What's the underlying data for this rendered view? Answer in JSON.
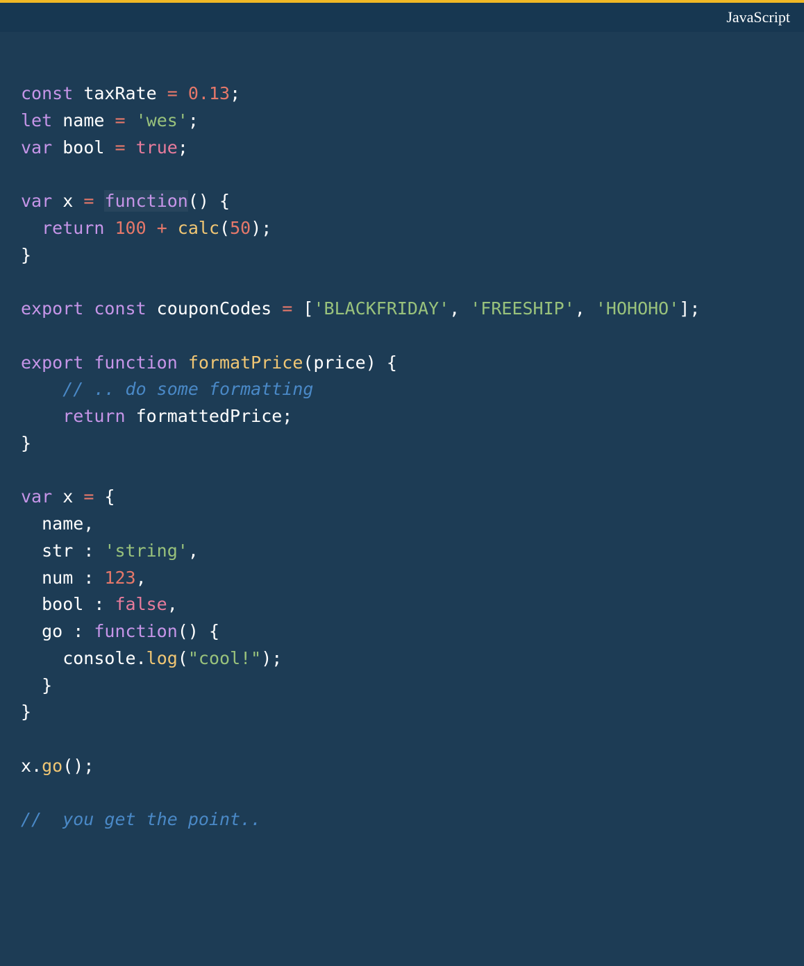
{
  "topbar": {
    "language_label": "JavaScript"
  },
  "colors": {
    "accent": "#f0b826",
    "topbar_bg": "#173751",
    "code_bg": "#1d3c55",
    "keyword": "#c695e8",
    "operator": "#e6786a",
    "number": "#e6786a",
    "string": "#99c27c",
    "boolean": "#e87c9c",
    "function": "#f0c674",
    "comment": "#4a89c7",
    "text": "#ffffff"
  },
  "code": {
    "tokens": [
      [
        {
          "t": "const ",
          "c": "kw-var"
        },
        {
          "t": "taxRate ",
          "c": "ident"
        },
        {
          "t": "= ",
          "c": "op"
        },
        {
          "t": "0.13",
          "c": "num"
        },
        {
          "t": ";",
          "c": "punct"
        }
      ],
      [
        {
          "t": "let ",
          "c": "kw-var"
        },
        {
          "t": "name ",
          "c": "ident"
        },
        {
          "t": "= ",
          "c": "op"
        },
        {
          "t": "'wes'",
          "c": "str"
        },
        {
          "t": ";",
          "c": "punct"
        }
      ],
      [
        {
          "t": "var ",
          "c": "kw-var"
        },
        {
          "t": "bool ",
          "c": "ident"
        },
        {
          "t": "= ",
          "c": "op"
        },
        {
          "t": "true",
          "c": "bool"
        },
        {
          "t": ";",
          "c": "punct"
        }
      ],
      [],
      [
        {
          "t": "var ",
          "c": "kw-var"
        },
        {
          "t": "x ",
          "c": "ident"
        },
        {
          "t": "= ",
          "c": "op"
        },
        {
          "t": "function",
          "c": "kw-var hl-bg"
        },
        {
          "t": "() {",
          "c": "punct"
        }
      ],
      [
        {
          "t": "  ",
          "c": "punct"
        },
        {
          "t": "return ",
          "c": "kw-var"
        },
        {
          "t": "100 ",
          "c": "num"
        },
        {
          "t": "+ ",
          "c": "op"
        },
        {
          "t": "calc",
          "c": "fn"
        },
        {
          "t": "(",
          "c": "punct"
        },
        {
          "t": "50",
          "c": "num"
        },
        {
          "t": ");",
          "c": "punct"
        }
      ],
      [
        {
          "t": "}",
          "c": "brace"
        }
      ],
      [],
      [
        {
          "t": "export ",
          "c": "kw-var"
        },
        {
          "t": "const ",
          "c": "kw-var"
        },
        {
          "t": "couponCodes ",
          "c": "ident"
        },
        {
          "t": "= ",
          "c": "op"
        },
        {
          "t": "[",
          "c": "punct"
        },
        {
          "t": "'BLACKFRIDAY'",
          "c": "str"
        },
        {
          "t": ", ",
          "c": "punct"
        },
        {
          "t": "'FREESHIP'",
          "c": "str"
        },
        {
          "t": ", ",
          "c": "punct"
        },
        {
          "t": "'HOHOHO'",
          "c": "str"
        },
        {
          "t": "];",
          "c": "punct"
        }
      ],
      [],
      [
        {
          "t": "export ",
          "c": "kw-var"
        },
        {
          "t": "function ",
          "c": "kw-var"
        },
        {
          "t": "formatPrice",
          "c": "fn"
        },
        {
          "t": "(price) {",
          "c": "punct"
        }
      ],
      [
        {
          "t": "    ",
          "c": "punct"
        },
        {
          "t": "// .. do some formatting",
          "c": "comment"
        }
      ],
      [
        {
          "t": "    ",
          "c": "punct"
        },
        {
          "t": "return ",
          "c": "kw-var"
        },
        {
          "t": "formattedPrice;",
          "c": "ident"
        }
      ],
      [
        {
          "t": "}",
          "c": "brace"
        }
      ],
      [],
      [
        {
          "t": "var ",
          "c": "kw-var"
        },
        {
          "t": "x ",
          "c": "ident"
        },
        {
          "t": "= ",
          "c": "op"
        },
        {
          "t": "{",
          "c": "brace"
        }
      ],
      [
        {
          "t": "  name,",
          "c": "ident"
        }
      ],
      [
        {
          "t": "  str ",
          "c": "ident"
        },
        {
          "t": ": ",
          "c": "punct"
        },
        {
          "t": "'string'",
          "c": "str"
        },
        {
          "t": ",",
          "c": "punct"
        }
      ],
      [
        {
          "t": "  num ",
          "c": "ident"
        },
        {
          "t": ": ",
          "c": "punct"
        },
        {
          "t": "123",
          "c": "num"
        },
        {
          "t": ",",
          "c": "punct"
        }
      ],
      [
        {
          "t": "  bool ",
          "c": "ident"
        },
        {
          "t": ": ",
          "c": "punct"
        },
        {
          "t": "false",
          "c": "bool"
        },
        {
          "t": ",",
          "c": "punct"
        }
      ],
      [
        {
          "t": "  go ",
          "c": "ident"
        },
        {
          "t": ": ",
          "c": "punct"
        },
        {
          "t": "function",
          "c": "kw-var"
        },
        {
          "t": "() {",
          "c": "punct"
        }
      ],
      [
        {
          "t": "    console",
          "c": "ident"
        },
        {
          "t": ".",
          "c": "dot"
        },
        {
          "t": "log",
          "c": "fn"
        },
        {
          "t": "(",
          "c": "punct"
        },
        {
          "t": "\"cool!\"",
          "c": "str"
        },
        {
          "t": ");",
          "c": "punct"
        }
      ],
      [
        {
          "t": "  }",
          "c": "brace"
        }
      ],
      [
        {
          "t": "}",
          "c": "brace"
        }
      ],
      [],
      [
        {
          "t": "x",
          "c": "ident"
        },
        {
          "t": ".",
          "c": "dot"
        },
        {
          "t": "go",
          "c": "fn"
        },
        {
          "t": "();",
          "c": "punct"
        }
      ],
      [],
      [
        {
          "t": "//  you get the point..",
          "c": "comment"
        }
      ]
    ]
  }
}
